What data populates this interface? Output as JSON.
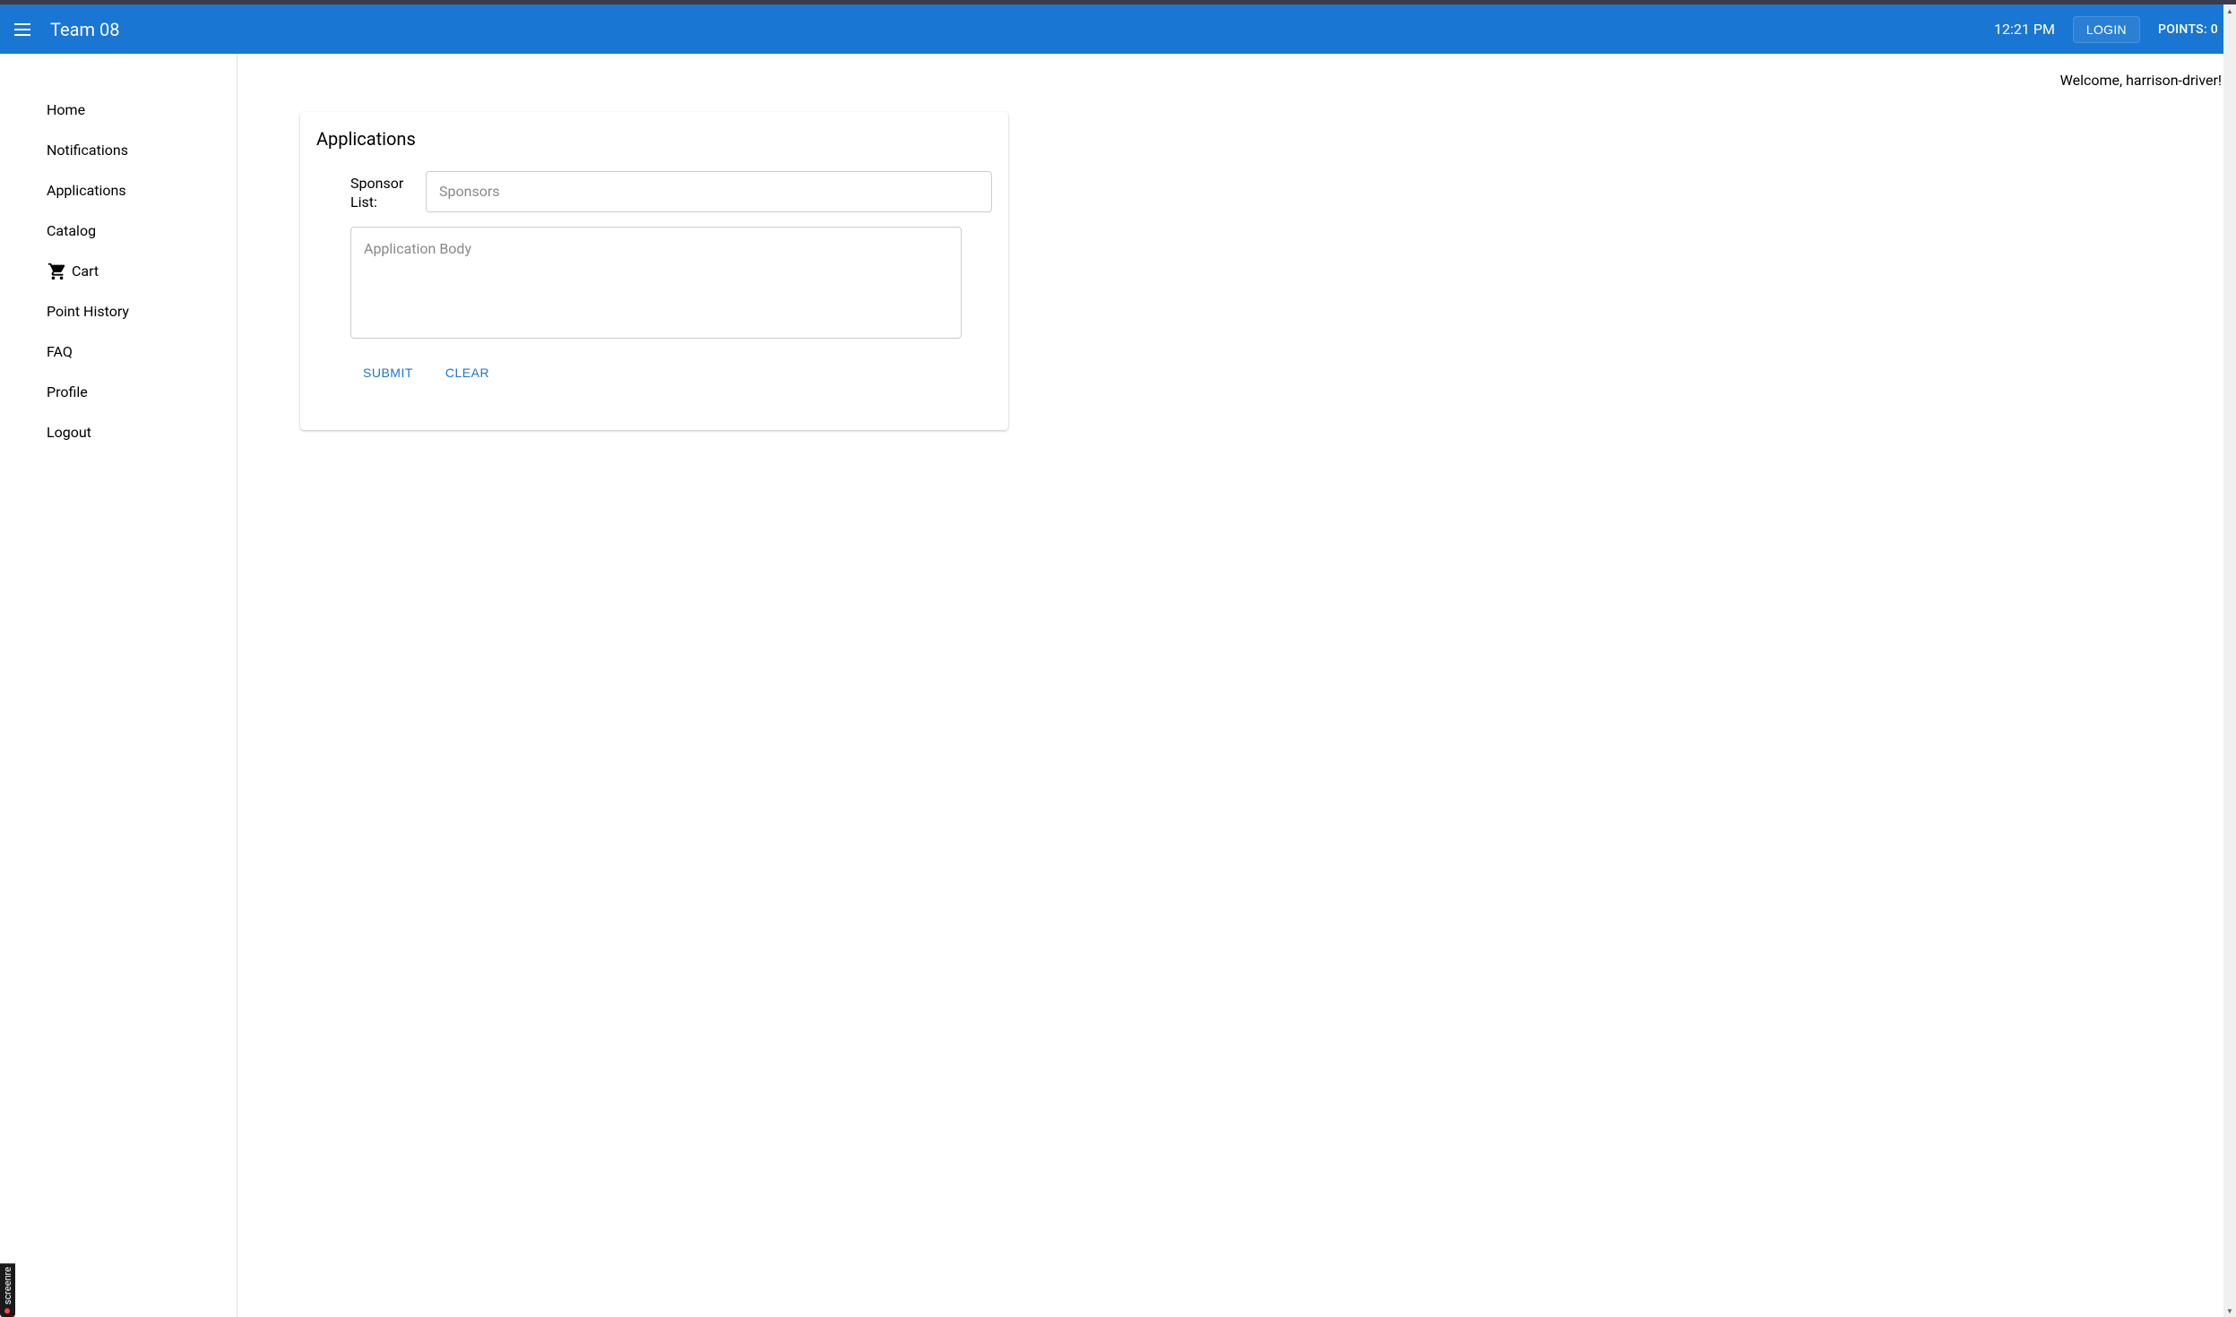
{
  "header": {
    "title": "Team 08",
    "time": "12:21 PM",
    "login_label": "LOGIN",
    "points_label": "POINTS: 0"
  },
  "sidebar": {
    "items": [
      {
        "label": "Home",
        "icon": null
      },
      {
        "label": "Notifications",
        "icon": null
      },
      {
        "label": "Applications",
        "icon": null
      },
      {
        "label": "Catalog",
        "icon": null
      },
      {
        "label": "Cart",
        "icon": "cart"
      },
      {
        "label": "Point History",
        "icon": null
      },
      {
        "label": "FAQ",
        "icon": null
      },
      {
        "label": "Profile",
        "icon": null
      },
      {
        "label": "Logout",
        "icon": null
      }
    ]
  },
  "main": {
    "welcome": "Welcome, harrison-driver!",
    "card": {
      "title": "Applications",
      "sponsor_label": "Sponsor List:",
      "sponsor_placeholder": "Sponsors",
      "body_placeholder": "Application Body",
      "submit_label": "SUBMIT",
      "clear_label": "CLEAR"
    }
  },
  "badge": {
    "label": "screenre"
  }
}
